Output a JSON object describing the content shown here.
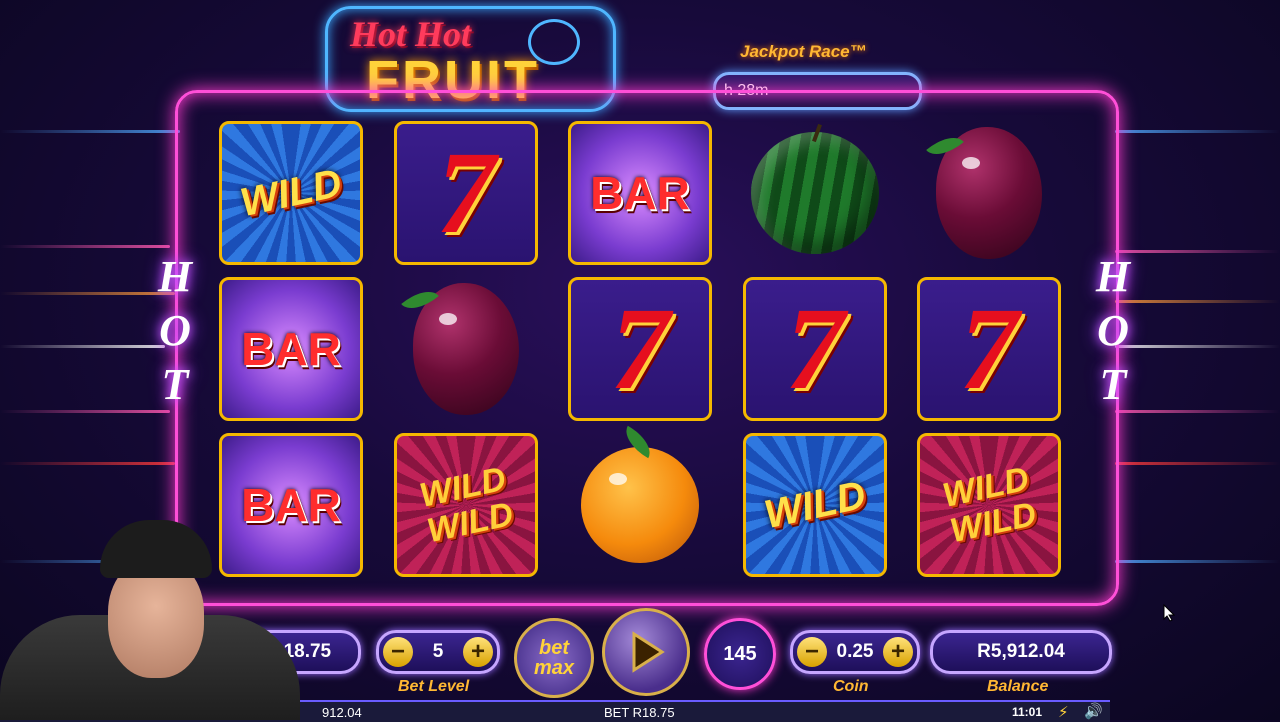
{
  "logo": {
    "line1": "Hot Hot",
    "line2": "FRUIT"
  },
  "jackpot": {
    "title": "Jackpot Race™",
    "timer": "h 28m"
  },
  "side": {
    "left": "HOT",
    "right": "HOT"
  },
  "reels": {
    "row1": [
      "WILD",
      "7",
      "BAR",
      "watermelon",
      "plum"
    ],
    "row2": [
      "BAR",
      "plum",
      "7",
      "7",
      "7"
    ],
    "row3": [
      "BAR",
      "WILD WILD",
      "orange",
      "WILD",
      "WILD WILD"
    ]
  },
  "symbols": {
    "wild": "WILD",
    "wild_top": "WILD",
    "wild_bottom": "WILD",
    "bar": "BAR",
    "seven": "7"
  },
  "controls": {
    "bet_value": "R18.75",
    "bet_level_value": "5",
    "bet_level_label": "Bet Level",
    "bet_max_line1": "bet",
    "bet_max_line2": "max",
    "autoplay_count": "145",
    "coin_value": "0.25",
    "coin_label": "Coin",
    "balance_value": "R5,912.04",
    "balance_label": "Balance",
    "minus": "−",
    "plus": "+"
  },
  "statusbar": {
    "left_balance": "912.04",
    "bet": "BET R18.75",
    "time": "11:01"
  },
  "colors": {
    "frame": "#ff4fd8",
    "gold": "#f5b800",
    "accent": "#ffb733"
  }
}
